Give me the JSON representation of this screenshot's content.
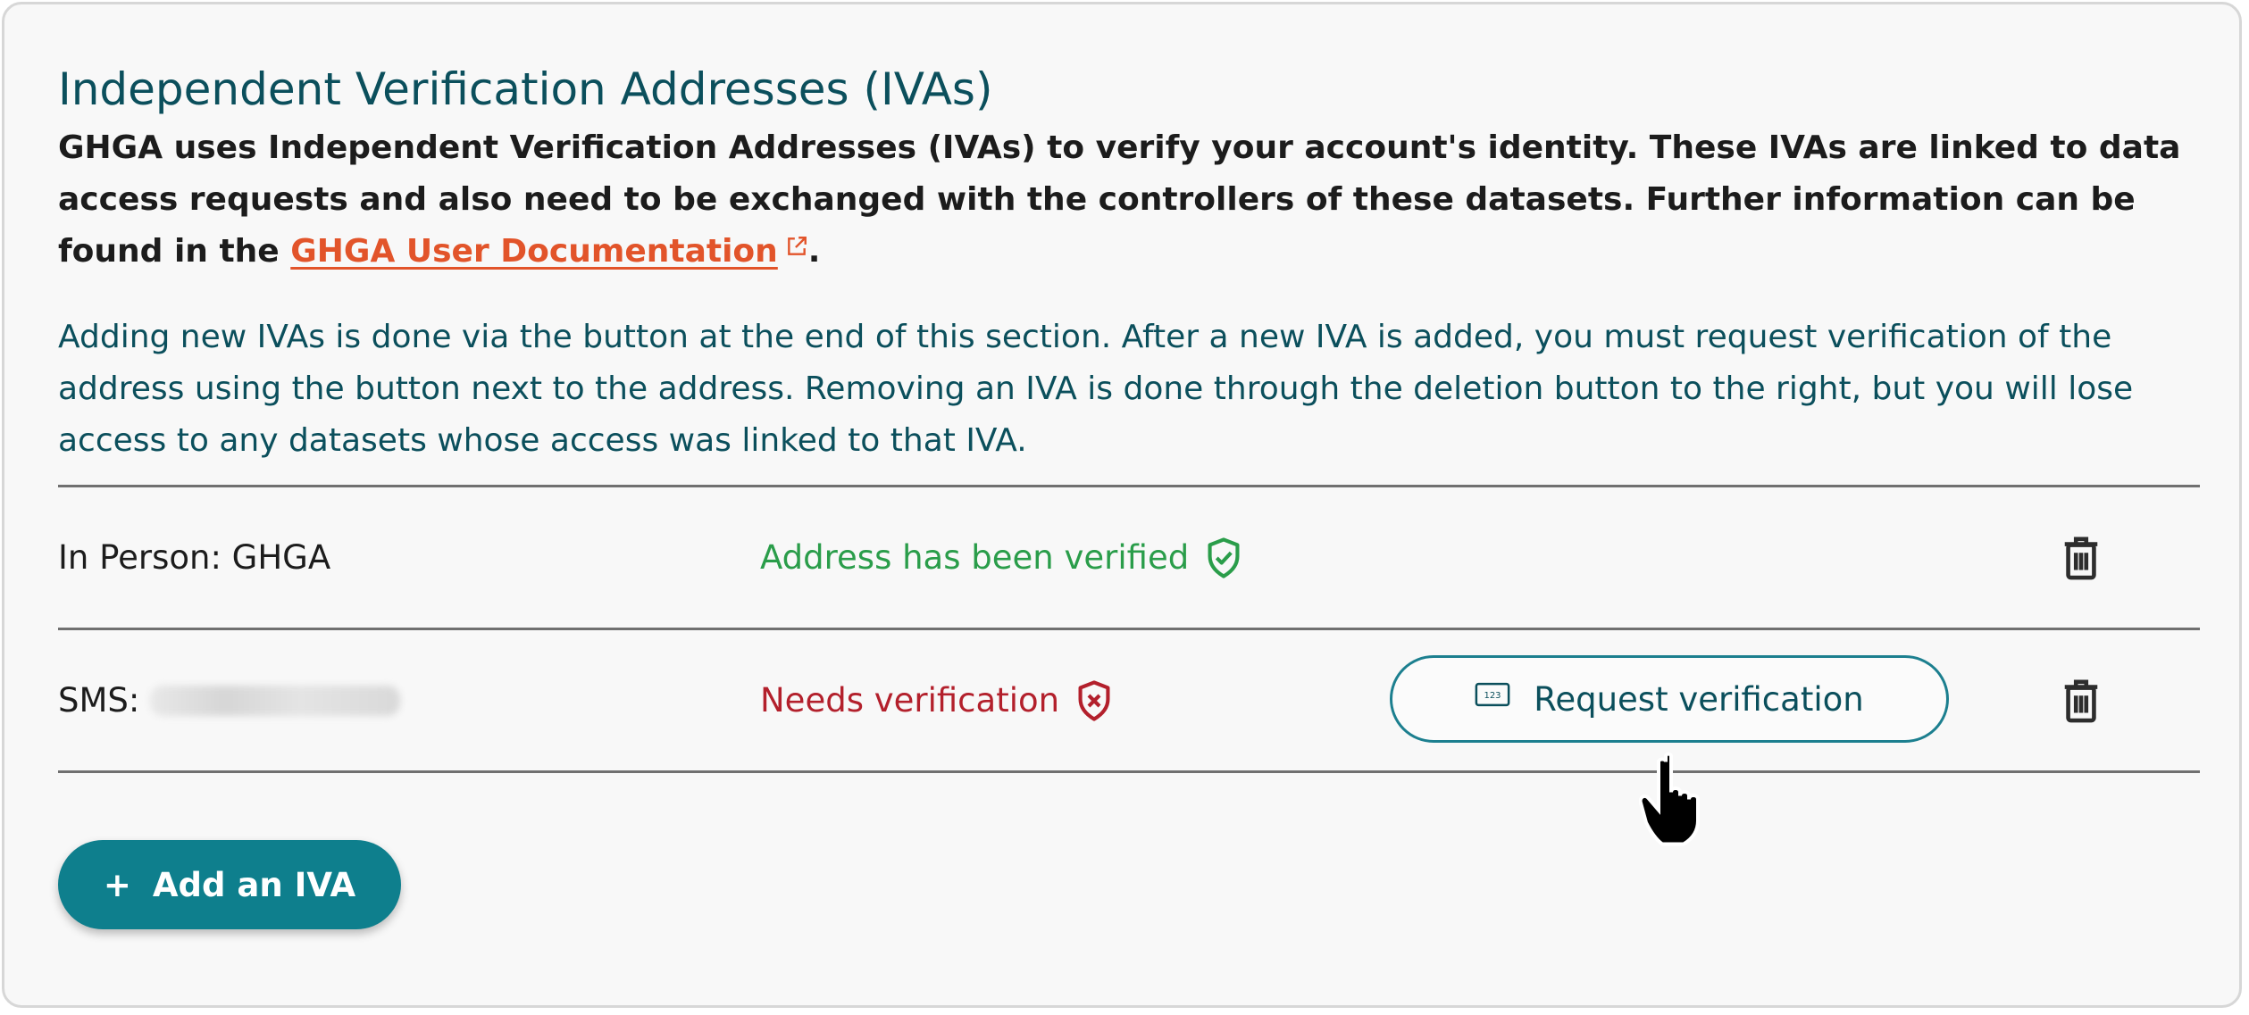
{
  "section": {
    "title": "Independent Verification Addresses (IVAs)",
    "intro_before_link": "GHGA uses Independent Verification Addresses (IVAs) to verify your account's identity. These IVAs are linked to data access requests and also need to be exchanged with the controllers of these datasets. Further information can be found in the ",
    "link_text": "GHGA User Documentation",
    "intro_after_link": ".",
    "paragraph": "Adding new IVAs is done via the button at the end of this section. After a new IVA is added, you must request verification of the address using the button next to the address. Removing an IVA is done through the deletion button to the right, but you will lose access to any datasets whose access was linked to that IVA."
  },
  "ivas": [
    {
      "label": "In Person: GHGA",
      "status_text": "Address has been verified",
      "status_icon": "shield-check-icon",
      "status_color": "#2a9d4a"
    },
    {
      "label": "SMS:",
      "value_masked": true,
      "status_text": "Needs verification",
      "status_icon": "shield-x-icon",
      "status_color": "#b3202c",
      "action_label": "Request verification"
    }
  ],
  "add_button": {
    "icon": "+",
    "label": "Add an IVA"
  },
  "colors": {
    "heading": "#0b4f5c",
    "link": "#e2542a",
    "primary": "#0e7f8d",
    "verified": "#2a9d4a",
    "unverified": "#b3202c"
  }
}
